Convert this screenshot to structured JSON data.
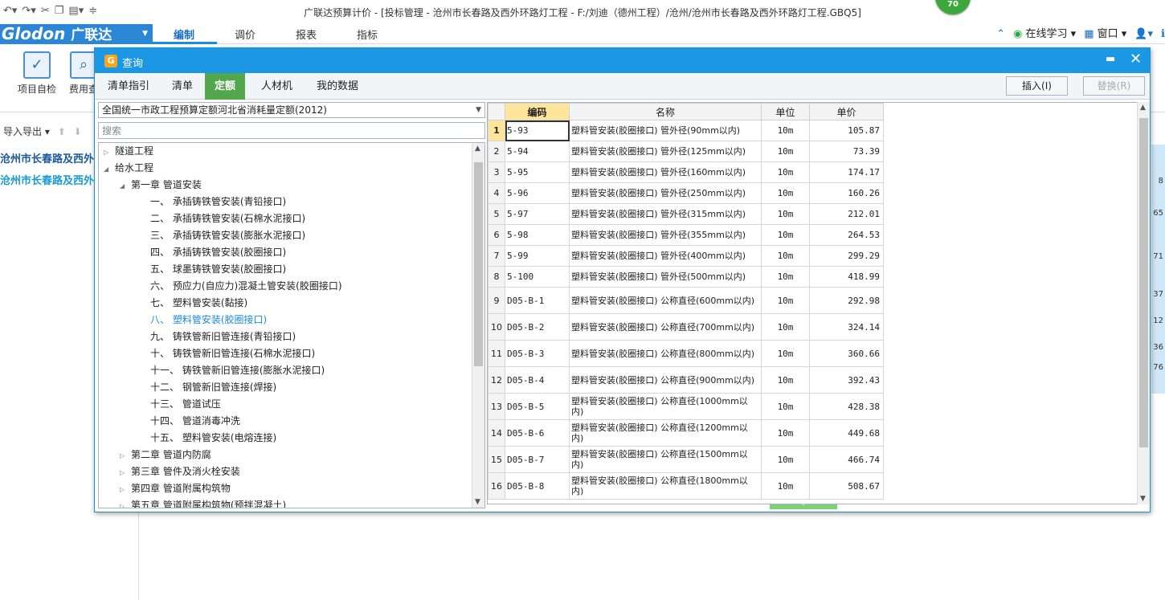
{
  "window": {
    "title": "广联达预算计价 - [投标管理 - 沧州市长春路及西外环路灯工程 - F:/刘迪（德州工程）/沧州/沧州市长春路及西外环路灯工程.GBQ5]",
    "badge": "70"
  },
  "app": {
    "logo": "Glodon",
    "logo_cn": "广联达"
  },
  "ribbon_tabs": [
    {
      "label": "编制",
      "active": true
    },
    {
      "label": "调价"
    },
    {
      "label": "报表"
    },
    {
      "label": "指标"
    }
  ],
  "right_menu": {
    "learn": "在线学习",
    "window": "窗口"
  },
  "ribbon_buttons": [
    {
      "label": "项目自检",
      "icon": "check-report-icon"
    },
    {
      "label": "费用查",
      "icon": "cost-search-icon"
    }
  ],
  "left_panel": {
    "import_export": "导入导出",
    "projects": [
      "沧州市长春路及西外环",
      "沧州市长春路及西外环"
    ]
  },
  "background_numbers": [
    "8",
    "65",
    "71",
    "37",
    "12",
    "36",
    "76"
  ],
  "dialog": {
    "title": "查询",
    "tabs": [
      {
        "label": "清单指引"
      },
      {
        "label": "清单"
      },
      {
        "label": "定额",
        "active": true
      },
      {
        "label": "人材机"
      },
      {
        "label": "我的数据"
      }
    ],
    "insert_button": "插入(I)",
    "replace_button": "替换(R)",
    "library_select": "全国统一市政工程预算定额河北省消耗量定额(2012)",
    "search_placeholder": "搜索",
    "tree": [
      {
        "label": "隧道工程",
        "level": 0,
        "state": "collapsed"
      },
      {
        "label": "给水工程",
        "level": 0,
        "state": "expanded"
      },
      {
        "label": "第一章  管道安装",
        "level": 1,
        "state": "expanded"
      },
      {
        "label": "一、  承插铸铁管安装(青铅接口)",
        "level": 2
      },
      {
        "label": "二、  承插铸铁管安装(石棉水泥接口)",
        "level": 2
      },
      {
        "label": "三、  承插铸铁管安装(膨胀水泥接口)",
        "level": 2
      },
      {
        "label": "四、  承插铸铁管安装(胶圈接口)",
        "level": 2
      },
      {
        "label": "五、  球墨铸铁管安装(胶圈接口)",
        "level": 2
      },
      {
        "label": "六、  预应力(自应力)混凝土管安装(胶圈接口)",
        "level": 2
      },
      {
        "label": "七、  塑料管安装(黏接)",
        "level": 2
      },
      {
        "label": "八、  塑料管安装(胶圈接口)",
        "level": 2,
        "selected": true
      },
      {
        "label": "九、  铸铁管新旧管连接(青铅接口)",
        "level": 2
      },
      {
        "label": "十、  铸铁管新旧管连接(石棉水泥接口)",
        "level": 2
      },
      {
        "label": "十一、  铸铁管新旧管连接(膨胀水泥接口)",
        "level": 2
      },
      {
        "label": "十二、  钢管新旧管连接(焊接)",
        "level": 2
      },
      {
        "label": "十三、  管道试压",
        "level": 2
      },
      {
        "label": "十四、  管道消毒冲洗",
        "level": 2
      },
      {
        "label": "十五、  塑料管安装(电熔连接)",
        "level": 2
      },
      {
        "label": "第二章  管道内防腐",
        "level": 1,
        "state": "collapsed"
      },
      {
        "label": "第三章  管件及消火栓安装",
        "level": 1,
        "state": "collapsed"
      },
      {
        "label": "第四章  管道附属构筑物",
        "level": 1,
        "state": "collapsed"
      },
      {
        "label": "第五章  管道附属构筑物(预拌混凝土)",
        "level": 1,
        "state": "collapsed"
      }
    ],
    "grid": {
      "columns": [
        "编码",
        "名称",
        "单位",
        "单价"
      ],
      "rows": [
        {
          "no": "1",
          "code": "5-93",
          "name": "塑料管安装(胶圈接口) 管外径(90mm以内)",
          "unit": "10m",
          "price": "105.87"
        },
        {
          "no": "2",
          "code": "5-94",
          "name": "塑料管安装(胶圈接口) 管外径(125mm以内)",
          "unit": "10m",
          "price": "73.39"
        },
        {
          "no": "3",
          "code": "5-95",
          "name": "塑料管安装(胶圈接口) 管外径(160mm以内)",
          "unit": "10m",
          "price": "174.17"
        },
        {
          "no": "4",
          "code": "5-96",
          "name": "塑料管安装(胶圈接口) 管外径(250mm以内)",
          "unit": "10m",
          "price": "160.26"
        },
        {
          "no": "5",
          "code": "5-97",
          "name": "塑料管安装(胶圈接口) 管外径(315mm以内)",
          "unit": "10m",
          "price": "212.01"
        },
        {
          "no": "6",
          "code": "5-98",
          "name": "塑料管安装(胶圈接口) 管外径(355mm以内)",
          "unit": "10m",
          "price": "264.53"
        },
        {
          "no": "7",
          "code": "5-99",
          "name": "塑料管安装(胶圈接口) 管外径(400mm以内)",
          "unit": "10m",
          "price": "299.29"
        },
        {
          "no": "8",
          "code": "5-100",
          "name": "塑料管安装(胶圈接口) 管外径(500mm以内)",
          "unit": "10m",
          "price": "418.99"
        },
        {
          "no": "9",
          "code": "D05-B-1",
          "name": "塑料管安装(胶圈接口) 公称直径(600mm以内)",
          "unit": "10m",
          "price": "292.98"
        },
        {
          "no": "10",
          "code": "D05-B-2",
          "name": "塑料管安装(胶圈接口) 公称直径(700mm以内)",
          "unit": "10m",
          "price": "324.14"
        },
        {
          "no": "11",
          "code": "D05-B-3",
          "name": "塑料管安装(胶圈接口) 公称直径(800mm以内)",
          "unit": "10m",
          "price": "360.66"
        },
        {
          "no": "12",
          "code": "D05-B-4",
          "name": "塑料管安装(胶圈接口) 公称直径(900mm以内)",
          "unit": "10m",
          "price": "392.43"
        },
        {
          "no": "13",
          "code": "D05-B-5",
          "name": "塑料管安装(胶圈接口) 公称直径(1000mm以内)",
          "unit": "10m",
          "price": "428.38"
        },
        {
          "no": "14",
          "code": "D05-B-6",
          "name": "塑料管安装(胶圈接口) 公称直径(1200mm以内)",
          "unit": "10m",
          "price": "449.68"
        },
        {
          "no": "15",
          "code": "D05-B-7",
          "name": "塑料管安装(胶圈接口) 公称直径(1500mm以内)",
          "unit": "10m",
          "price": "466.74"
        },
        {
          "no": "16",
          "code": "D05-B-8",
          "name": "塑料管安装(胶圈接口) 公称直径(1800mm以内)",
          "unit": "10m",
          "price": "508.67"
        }
      ]
    }
  },
  "colors": {
    "accent": "#1c97e4",
    "active_tab": "#52a64b",
    "selected_header": "#ffe599"
  }
}
